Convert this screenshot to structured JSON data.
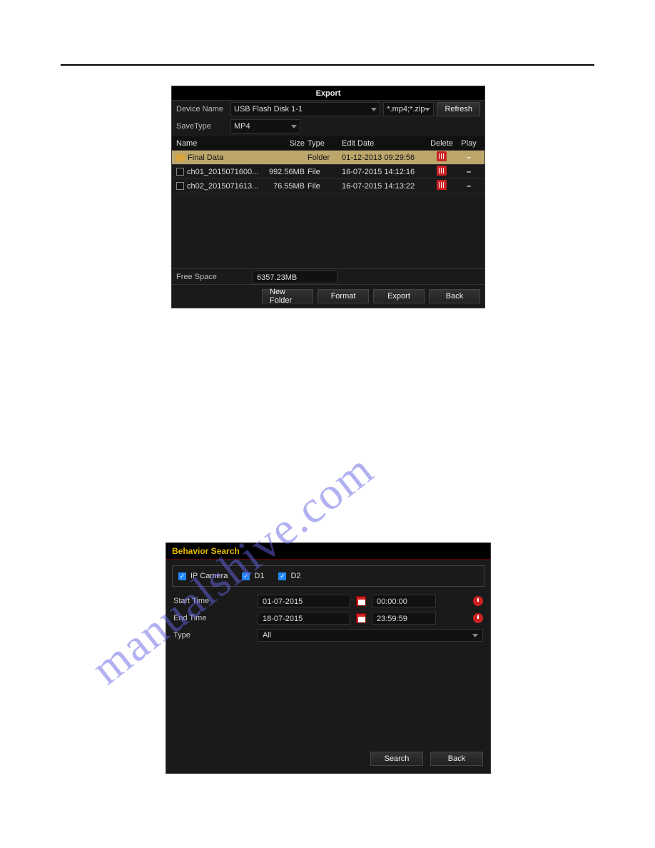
{
  "export": {
    "title": "Export",
    "deviceNameLabel": "Device Name",
    "deviceName": "USB Flash Disk 1-1",
    "fileFilter": "*.mp4;*.zip",
    "refresh": "Refresh",
    "saveTypeLabel": "SaveType",
    "saveType": "MP4",
    "columns": {
      "name": "Name",
      "size": "Size",
      "type": "Type",
      "date": "Edit Date",
      "del": "Delete",
      "play": "Play"
    },
    "rows": [
      {
        "name": "Final Data",
        "isFolder": true,
        "size": "",
        "type": "Folder",
        "date": "01-12-2013 09:29:56",
        "play": "–",
        "selected": true
      },
      {
        "name": "ch01_2015071600...",
        "isFolder": false,
        "size": "992.56MB",
        "type": "File",
        "date": "16-07-2015 14:12:16",
        "play": "–",
        "selected": false
      },
      {
        "name": "ch02_2015071613...",
        "isFolder": false,
        "size": "76.55MB",
        "type": "File",
        "date": "16-07-2015 14:13:22",
        "play": "–",
        "selected": false
      }
    ],
    "freeSpaceLabel": "Free Space",
    "freeSpace": "6357.23MB",
    "buttons": {
      "newFolder": "New Folder",
      "format": "Format",
      "export": "Export",
      "back": "Back"
    }
  },
  "behavior": {
    "title": "Behavior Search",
    "ipCamera": "IP Camera",
    "d1": "D1",
    "d2": "D2",
    "startLabel": "Start Time",
    "startDate": "01-07-2015",
    "startTime": "00:00:00",
    "endLabel": "End Time",
    "endDate": "18-07-2015",
    "endTime": "23:59:59",
    "typeLabel": "Type",
    "typeValue": "All",
    "search": "Search",
    "back": "Back"
  },
  "watermark": "manualshive.com"
}
